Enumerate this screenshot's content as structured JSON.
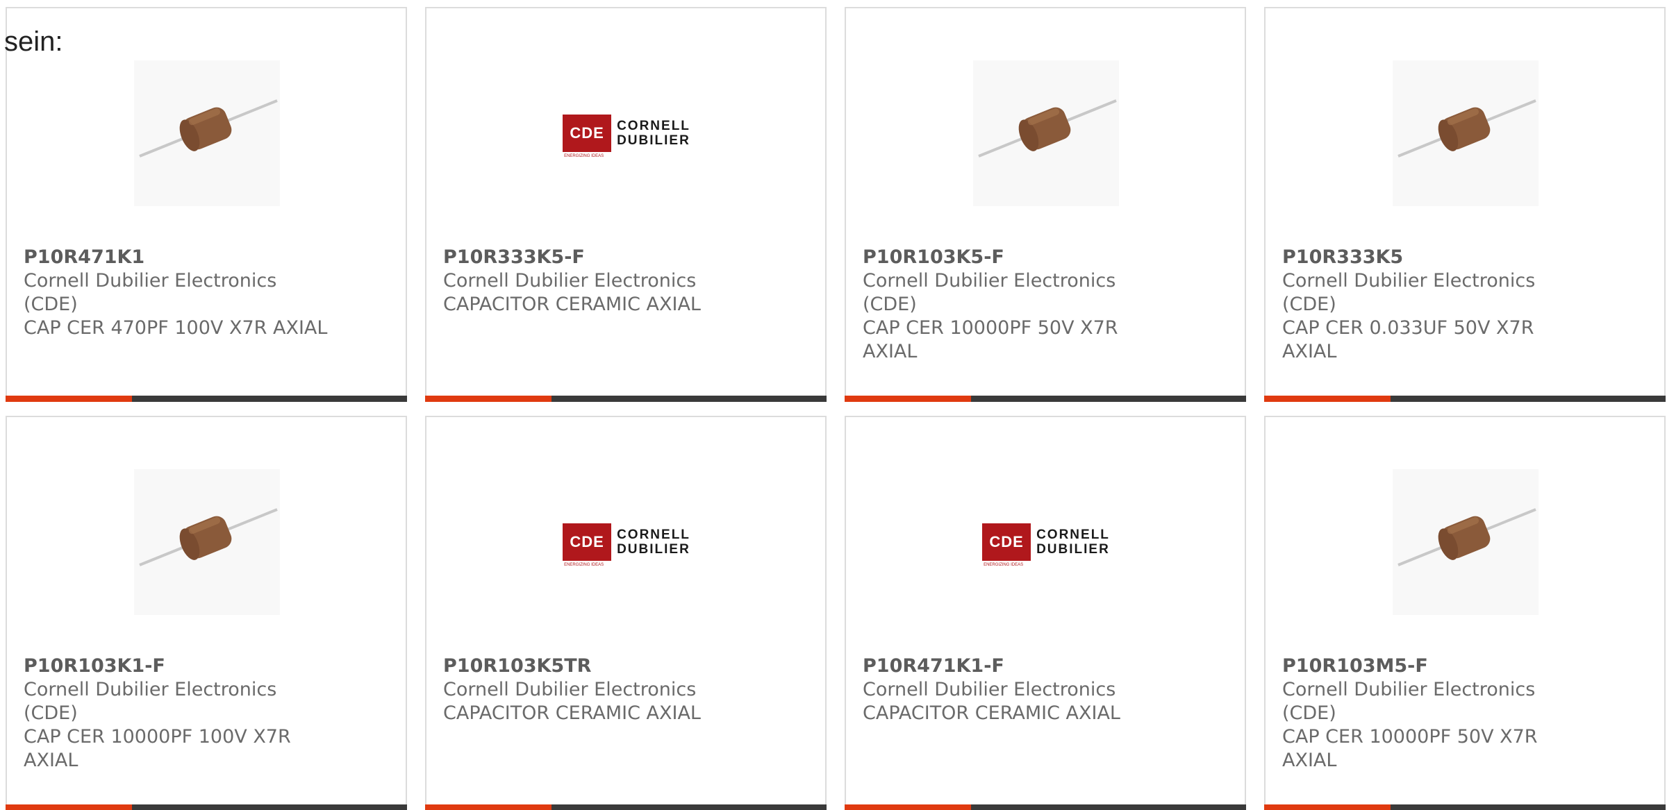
{
  "heading": "sein:",
  "icons": {
    "capacitor": "axial-capacitor-image",
    "brand_logo": "cornell-dubilier-logo"
  },
  "colors": {
    "accent": "#e03a10",
    "bar": "#3a3a3a",
    "logo_red": "#b0181c"
  },
  "logo": {
    "mark": "CDE",
    "line1": "CORNELL",
    "line2": "DUBILIER",
    "tagline": "ENERGIZING IDEAS"
  },
  "products": [
    {
      "part": "P10R471K1",
      "maker": "Cornell Dubilier Electronics (CDE)",
      "desc": "CAP CER 470PF 100V X7R AXIAL",
      "image": "capacitor"
    },
    {
      "part": "P10R333K5-F",
      "maker": "Cornell Dubilier Electronics",
      "desc": "CAPACITOR CERAMIC AXIAL",
      "image": "logo"
    },
    {
      "part": "P10R103K5-F",
      "maker": "Cornell Dubilier Electronics (CDE)",
      "desc": "CAP CER 10000PF 50V X7R AXIAL",
      "image": "capacitor"
    },
    {
      "part": "P10R333K5",
      "maker": "Cornell Dubilier Electronics (CDE)",
      "desc": "CAP CER 0.033UF 50V X7R AXIAL",
      "image": "capacitor"
    },
    {
      "part": "P10R103K1-F",
      "maker": "Cornell Dubilier Electronics (CDE)",
      "desc": "CAP CER 10000PF 100V X7R AXIAL",
      "image": "capacitor"
    },
    {
      "part": "P10R103K5TR",
      "maker": "Cornell Dubilier Electronics",
      "desc": "CAPACITOR CERAMIC AXIAL",
      "image": "logo"
    },
    {
      "part": "P10R471K1-F",
      "maker": "Cornell Dubilier Electronics",
      "desc": "CAPACITOR CERAMIC AXIAL",
      "image": "logo"
    },
    {
      "part": "P10R103M5-F",
      "maker": "Cornell Dubilier Electronics (CDE)",
      "desc": "CAP CER 10000PF 50V X7R AXIAL",
      "image": "capacitor"
    }
  ]
}
